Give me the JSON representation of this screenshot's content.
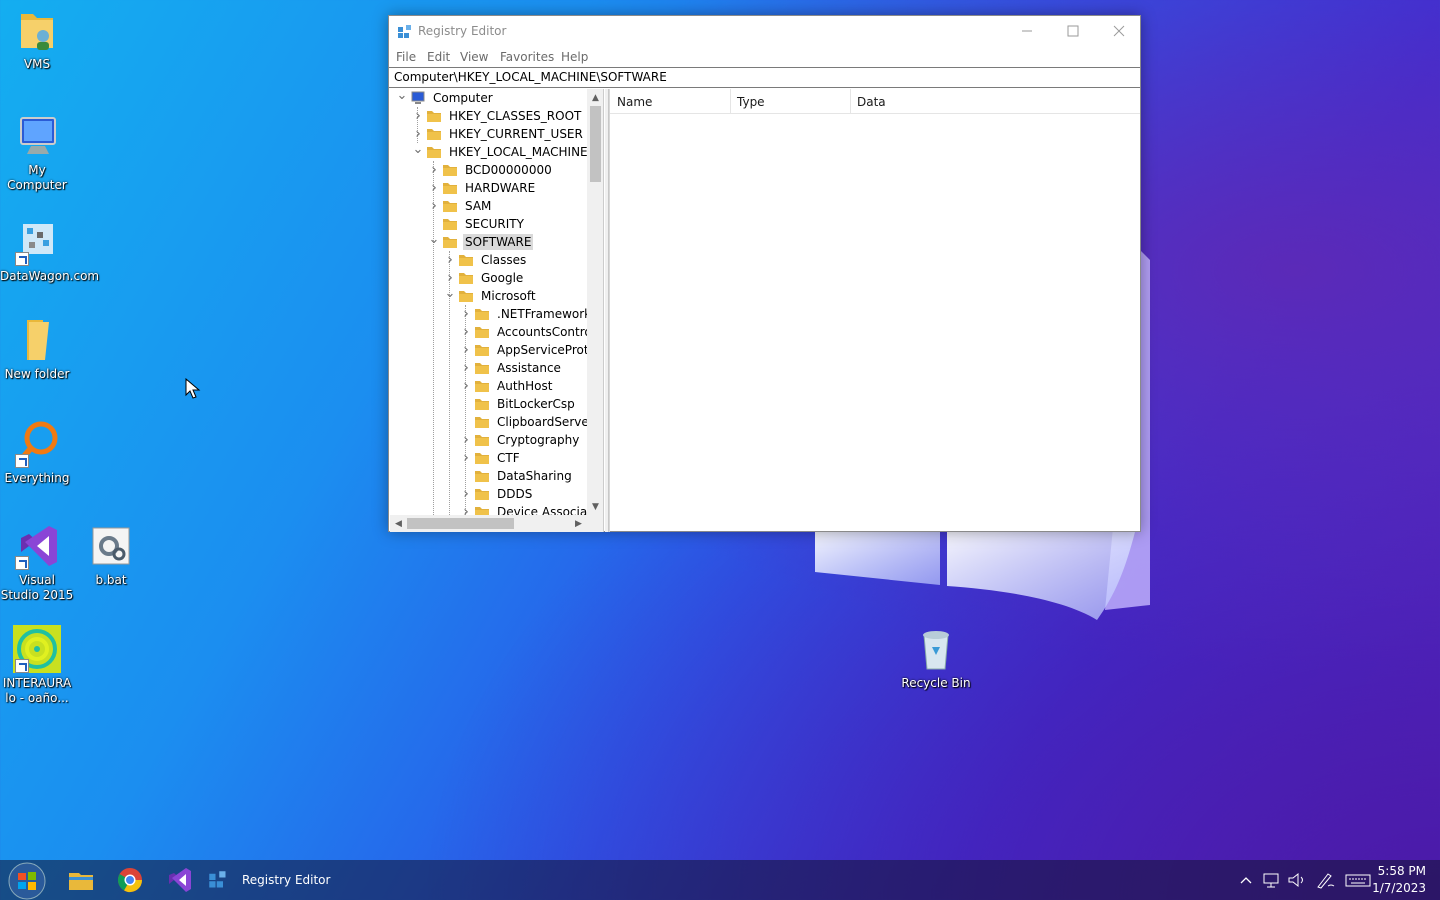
{
  "desktop": {
    "icons": [
      {
        "label": "VMS"
      },
      {
        "label": "My Computer"
      },
      {
        "label": "DataWagon.com"
      },
      {
        "label": "New folder"
      },
      {
        "label": "Everything"
      },
      {
        "label": "Visual Studio 2015"
      },
      {
        "label": "b.bat"
      },
      {
        "label": "INTERAURA lo - oaño..."
      },
      {
        "label": "Recycle Bin"
      }
    ]
  },
  "window": {
    "title": "Registry Editor",
    "menu": [
      "File",
      "Edit",
      "View",
      "Favorites",
      "Help"
    ],
    "address": "Computer\\HKEY_LOCAL_MACHINE\\SOFTWARE",
    "columns": [
      "Name",
      "Type",
      "Data"
    ],
    "tree": [
      {
        "label": "Computer",
        "level": 0,
        "expanded": true,
        "icon": "computer-icon"
      },
      {
        "label": "HKEY_CLASSES_ROOT",
        "level": 1,
        "expanded": false
      },
      {
        "label": "HKEY_CURRENT_USER",
        "level": 1,
        "expanded": false
      },
      {
        "label": "HKEY_LOCAL_MACHINE",
        "level": 1,
        "expanded": true
      },
      {
        "label": "BCD00000000",
        "level": 2,
        "expanded": false
      },
      {
        "label": "HARDWARE",
        "level": 2,
        "expanded": false
      },
      {
        "label": "SAM",
        "level": 2,
        "expanded": false
      },
      {
        "label": "SECURITY",
        "level": 2,
        "expanded": null
      },
      {
        "label": "SOFTWARE",
        "level": 2,
        "expanded": true,
        "selected": true
      },
      {
        "label": "Classes",
        "level": 3,
        "expanded": false
      },
      {
        "label": "Google",
        "level": 3,
        "expanded": false
      },
      {
        "label": "Microsoft",
        "level": 3,
        "expanded": true
      },
      {
        "label": ".NETFramework",
        "level": 4,
        "expanded": false
      },
      {
        "label": "AccountsControl",
        "level": 4,
        "expanded": false
      },
      {
        "label": "AppServiceProtoc",
        "level": 4,
        "expanded": false
      },
      {
        "label": "Assistance",
        "level": 4,
        "expanded": false
      },
      {
        "label": "AuthHost",
        "level": 4,
        "expanded": false
      },
      {
        "label": "BitLockerCsp",
        "level": 4,
        "expanded": null
      },
      {
        "label": "ClipboardServer",
        "level": 4,
        "expanded": null
      },
      {
        "label": "Cryptography",
        "level": 4,
        "expanded": false
      },
      {
        "label": "CTF",
        "level": 4,
        "expanded": false
      },
      {
        "label": "DataSharing",
        "level": 4,
        "expanded": null
      },
      {
        "label": "DDDS",
        "level": 4,
        "expanded": false
      },
      {
        "label": "Device Associatio",
        "level": 4,
        "expanded": false
      }
    ]
  },
  "taskbar": {
    "running_app": "Registry Editor",
    "time": "5:58 PM",
    "date": "1/7/2023"
  },
  "colors": {
    "folder": "#f0c24a",
    "selection": "#d9d9d9",
    "accent": "#1f5fbf"
  }
}
